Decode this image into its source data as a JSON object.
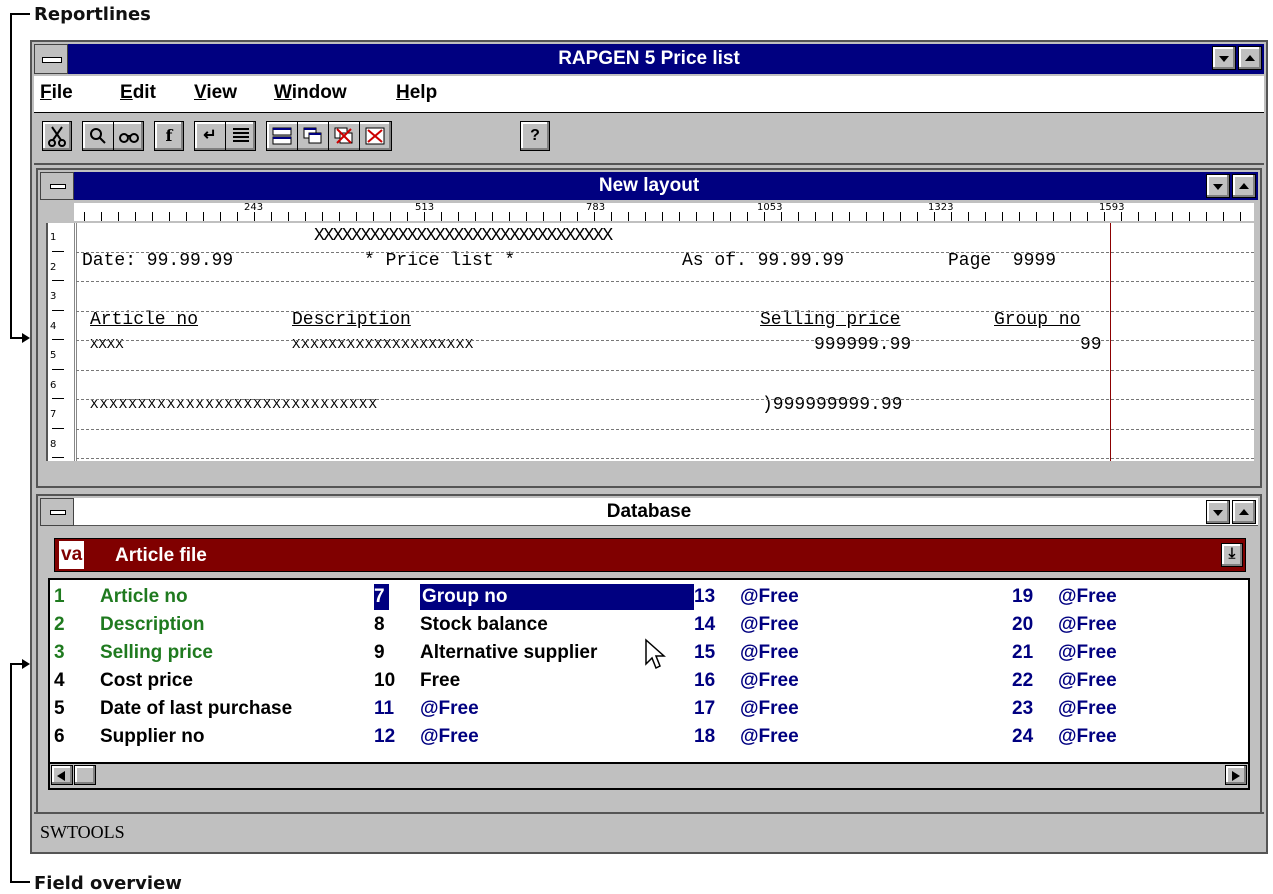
{
  "callouts": {
    "top": "Reportlines",
    "bottom": "Field overview"
  },
  "app": {
    "title": "RAPGEN 5 Price list",
    "status": "SWTOOLS"
  },
  "menu": [
    {
      "label": "File",
      "underline": "F",
      "rest": "ile"
    },
    {
      "label": "Edit",
      "underline": "E",
      "rest": "dit"
    },
    {
      "label": "View",
      "underline": "V",
      "rest": "iew"
    },
    {
      "label": "Window",
      "underline": "W",
      "rest": "indow"
    },
    {
      "label": "Help",
      "underline": "H",
      "rest": "elp"
    }
  ],
  "toolbar": {
    "icons": [
      "cut-icon",
      "search-icon",
      "find-replace-icon",
      "function-icon",
      "return-icon",
      "lines-icon",
      "window-tile-icon",
      "window-cascade-icon",
      "window-close-all-icon",
      "window-close-icon",
      "help-icon"
    ]
  },
  "layout": {
    "title": "New layout",
    "ruler": [
      "243",
      "513",
      "783",
      "1053",
      "1323",
      "1593"
    ],
    "line_numbers": [
      "1",
      "2",
      "3",
      "4",
      "5",
      "6",
      "7",
      "8"
    ],
    "lines": {
      "l1": "XXXXXXXXXXXXXXXXXXXXXXXXXXXXXXXX",
      "l2a": "Date: 99.99.99",
      "l2b": "* Price list *",
      "l2c": "As of. 99.99.99",
      "l2d": "Page  9999",
      "l4a": "Article no",
      "l4b": "Description",
      "l4c": "Selling price",
      "l4d": "Group no",
      "l5a": "XXXX",
      "l5b": "XXXXXXXXXXXXXXXXXXXX",
      "l5c": "999999.99",
      "l5d": "99",
      "l7a": "XXXXXXXXXXXXXXXXXXXXXXXXXXXXXX",
      "l7b": ")999999999.99"
    }
  },
  "database": {
    "title": "Database",
    "file_prefix": "va",
    "file": "Article file",
    "colors": {
      "green": "#1f7a1f",
      "black": "#000000",
      "blue": "#000080"
    },
    "fields": [
      {
        "num": "1",
        "label": "Article no",
        "color": "green"
      },
      {
        "num": "2",
        "label": "Description",
        "color": "green"
      },
      {
        "num": "3",
        "label": "Selling price",
        "color": "green"
      },
      {
        "num": "4",
        "label": "Cost price",
        "color": "black"
      },
      {
        "num": "5",
        "label": "Date of last purchase",
        "color": "black"
      },
      {
        "num": "6",
        "label": "Supplier no",
        "color": "black"
      },
      {
        "num": "7",
        "label": "Group no",
        "color": "selected"
      },
      {
        "num": "8",
        "label": "Stock balance",
        "color": "black"
      },
      {
        "num": "9",
        "label": "Alternative supplier",
        "color": "black"
      },
      {
        "num": "10",
        "label": "Free",
        "color": "black"
      },
      {
        "num": "11",
        "label": "@Free",
        "color": "blue"
      },
      {
        "num": "12",
        "label": "@Free",
        "color": "blue"
      },
      {
        "num": "13",
        "label": "@Free",
        "color": "blue"
      },
      {
        "num": "14",
        "label": "@Free",
        "color": "blue"
      },
      {
        "num": "15",
        "label": "@Free",
        "color": "blue"
      },
      {
        "num": "16",
        "label": "@Free",
        "color": "blue"
      },
      {
        "num": "17",
        "label": "@Free",
        "color": "blue"
      },
      {
        "num": "18",
        "label": "@Free",
        "color": "blue"
      },
      {
        "num": "19",
        "label": "@Free",
        "color": "blue"
      },
      {
        "num": "20",
        "label": "@Free",
        "color": "blue"
      },
      {
        "num": "21",
        "label": "@Free",
        "color": "blue"
      },
      {
        "num": "22",
        "label": "@Free",
        "color": "blue"
      },
      {
        "num": "23",
        "label": "@Free",
        "color": "blue"
      },
      {
        "num": "24",
        "label": "@Free",
        "color": "blue"
      }
    ]
  }
}
